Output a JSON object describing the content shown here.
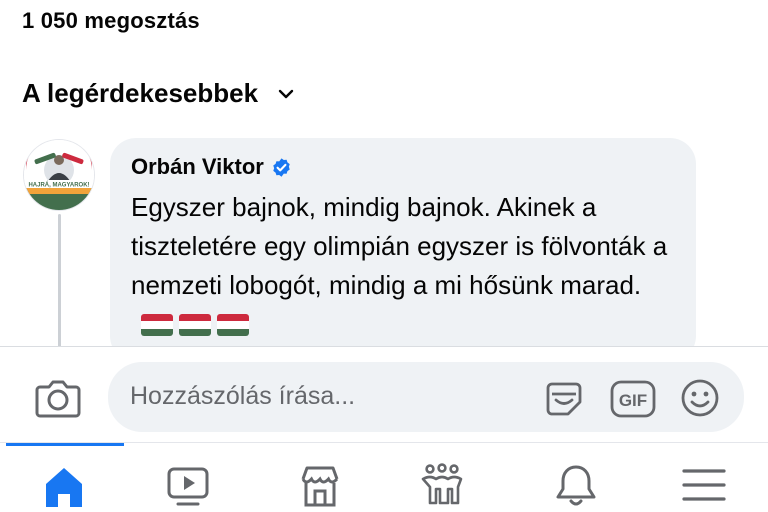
{
  "post": {
    "share_count": "1 050 megosztás"
  },
  "comments_sort": {
    "label": "A legérdekesebbek",
    "icon": "chevron-down-icon"
  },
  "comment": {
    "author": "Orbán Viktor",
    "verified": true,
    "text": "Egyszer bajnok, mindig bajnok. Akinek a tiszteletére egy olimpián egyszer is fölvonták a nemzeti lobogót, mindig a mi hősünk marad.",
    "emoji": [
      "hungary-flag",
      "hungary-flag",
      "hungary-flag"
    ],
    "avatar_caption": "HAJRÁ, MAGYAROK!"
  },
  "composer": {
    "placeholder": "Hozzászólás írása...",
    "icons": [
      "camera-icon",
      "sticker-icon",
      "gif-icon",
      "emoji-icon"
    ],
    "gif_label": "GIF"
  },
  "tabbar": {
    "tabs": [
      "home-icon",
      "video-icon",
      "marketplace-icon",
      "groups-icon",
      "notifications-icon",
      "menu-icon"
    ],
    "active": "home-icon"
  },
  "colors": {
    "accent": "#1877f2",
    "bubble": "#eff2f5",
    "secondary_text": "#65676b",
    "icon_gray": "#65676b",
    "flag_red": "#cd2a3e",
    "flag_green": "#436f4d"
  }
}
